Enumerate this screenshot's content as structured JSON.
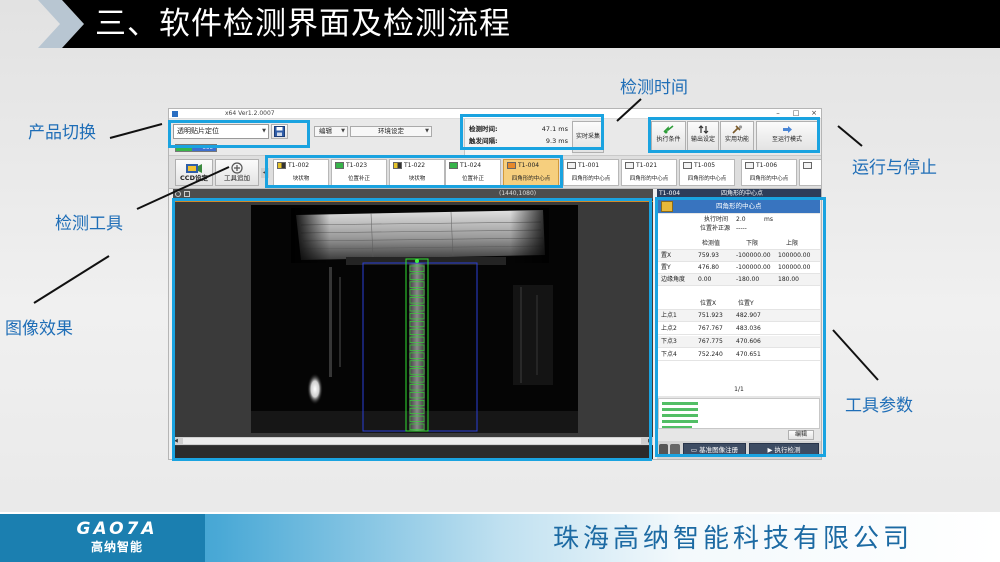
{
  "slide": {
    "title": "三、软件检测界面及检测流程",
    "company": "珠海高纳智能科技有限公司",
    "logo_mark": "GAO7A",
    "logo_name": "高纳智能"
  },
  "annotations": {
    "product_switch": "产品切换",
    "detection_tools": "检测工具",
    "image_effect": "图像效果",
    "detection_time": "检测时间",
    "run_stop": "运行与停止",
    "tool_params": "工具参数"
  },
  "colors": {
    "annotation_text": "#1f6eb7",
    "highlight_box": "#1aa3e0",
    "header_bar": "#000000",
    "brand": "#1b7fb0",
    "selected_tool": "#f6cf7e"
  },
  "app": {
    "window_title": "x64 Ver1.2.0007",
    "window_controls": [
      "–",
      "□",
      "×"
    ],
    "product_select": "透明贴片定位",
    "counter": "500",
    "menu": {
      "edit": "编辑",
      "environment": "环境设定"
    },
    "timing": {
      "detect_label": "检测时间:",
      "detect_value": "47.1 ms",
      "trigger_label": "触发间隔:",
      "trigger_value": "9.3 ms"
    },
    "live_capture": "实时采集",
    "buttons": {
      "exec_condition": "执行条件",
      "output_settings": "输出设定",
      "utilities": "实用功能",
      "run_mode": "至运行模式"
    },
    "ccd_settings": "CCD设定",
    "add_tool": "工具追加",
    "tools": [
      {
        "id": "T1-002",
        "name": "块状物"
      },
      {
        "id": "T1-023",
        "name": "位置补正"
      },
      {
        "id": "T1-022",
        "name": "块状物"
      },
      {
        "id": "T1-024",
        "name": "位置补正"
      },
      {
        "id": "T1-004",
        "name": "四角形的中心点"
      },
      {
        "id": "T1-001",
        "name": "四角形的中心点"
      },
      {
        "id": "T1-021",
        "name": "四角形的中心点"
      },
      {
        "id": "T1-005",
        "name": "四角形的中心点"
      },
      {
        "id": "T1-006",
        "name": "四角形的中心点"
      }
    ],
    "selected_tool_index": 4,
    "image_resolution": "(1440,1080)",
    "panel": {
      "header_id": "T1-004",
      "header_name": "四角形的中心点",
      "card_title": "四角形的中心点",
      "exec_time_label": "执行时间",
      "exec_time_value": "2.0",
      "exec_time_unit": "ms",
      "position_source_label": "位置补正源",
      "position_source_value": "-----",
      "result_headers": [
        "检测值",
        "下限",
        "上限"
      ],
      "results": [
        {
          "label": "置X",
          "value": "759.93",
          "min": "-100000.00",
          "max": "100000.00"
        },
        {
          "label": "置Y",
          "value": "476.80",
          "min": "-100000.00",
          "max": "100000.00"
        },
        {
          "label": "边缘角度",
          "value": "0.00",
          "min": "-180.00",
          "max": "180.00"
        }
      ],
      "point_headers": [
        "位置X",
        "位置Y"
      ],
      "points": [
        {
          "label": "上点1",
          "x": "751.923",
          "y": "482.907"
        },
        {
          "label": "上点2",
          "x": "767.767",
          "y": "483.036"
        },
        {
          "label": "下点3",
          "x": "767.775",
          "y": "470.606"
        },
        {
          "label": "下点4",
          "x": "752.240",
          "y": "470.651"
        }
      ],
      "page_indicator": "1/1",
      "edit_button": "编辑",
      "register_button": "基准图像注册",
      "run_detect_button": "执行检测"
    }
  }
}
